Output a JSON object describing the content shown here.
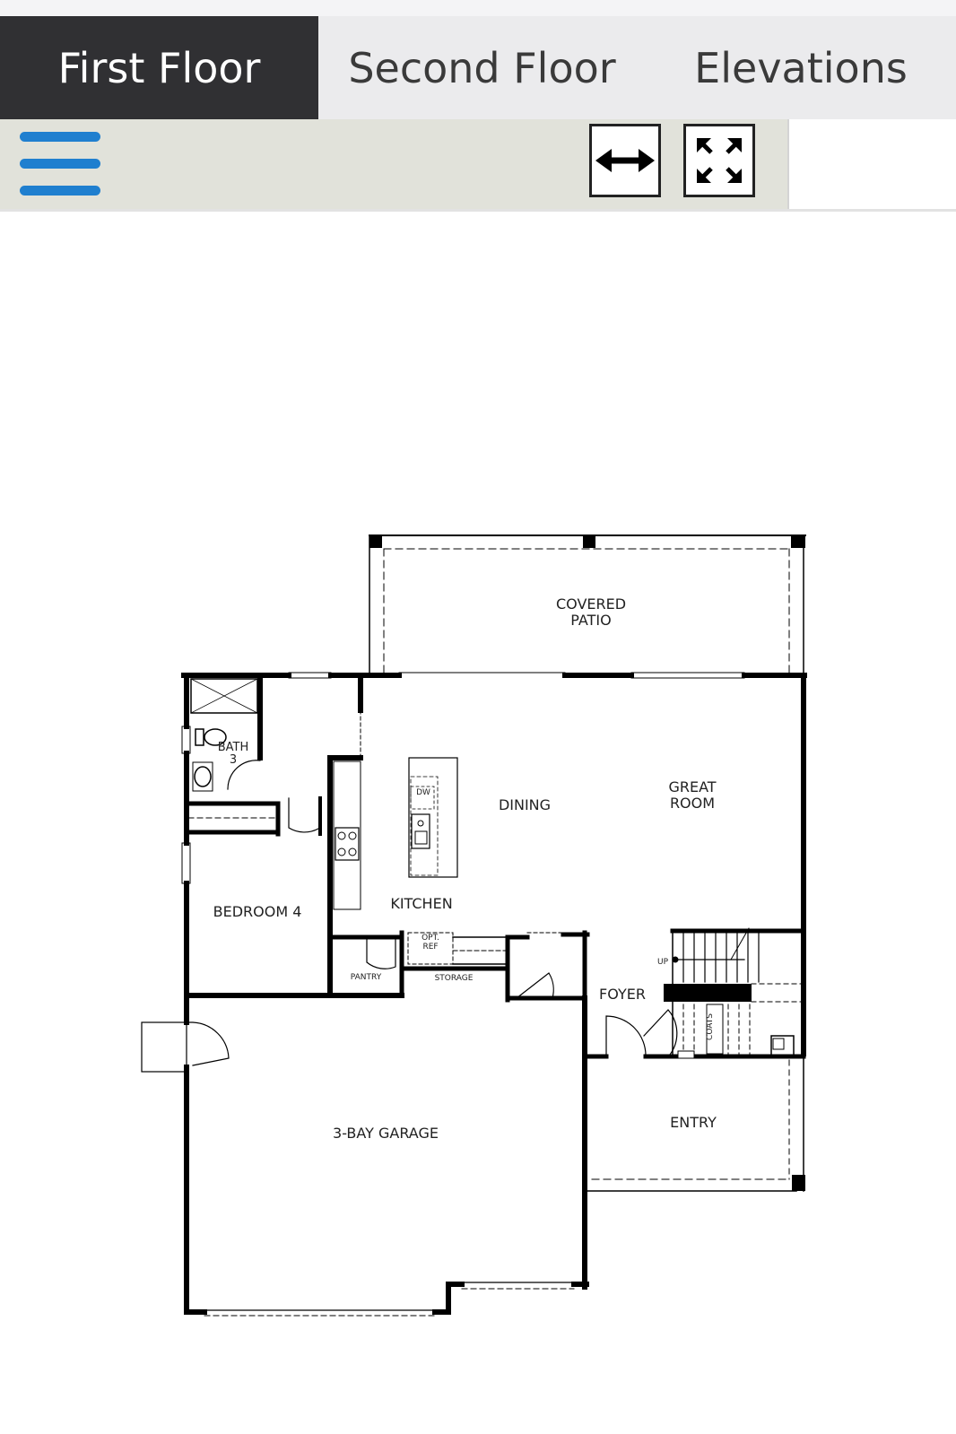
{
  "tabs": [
    {
      "label": "First Floor",
      "active": true
    },
    {
      "label": "Second Floor",
      "active": false
    },
    {
      "label": "Elevations",
      "active": false
    }
  ],
  "toolbar": {
    "menu_icon": "hamburger-menu-icon",
    "fit_width_icon": "horizontal-arrows-icon",
    "fullscreen_icon": "expand-arrows-icon"
  },
  "colors": {
    "active_tab_bg": "#303033",
    "tabbar_bg": "#ebebed",
    "toolbar_bg": "#e1e2da",
    "menu_icon": "#1f7fcf",
    "walls": "#000000"
  },
  "floorplan": {
    "rooms": {
      "covered_patio_1": "COVERED",
      "covered_patio_2": "PATIO",
      "bath_1": "BATH",
      "bath_2": "3",
      "dining": "DINING",
      "great_room_1": "GREAT",
      "great_room_2": "ROOM",
      "kitchen": "KITCHEN",
      "bedroom_4": "BEDROOM 4",
      "pantry": "PANTRY",
      "storage": "STORAGE",
      "opt_ref_1": "OPT.",
      "opt_ref_2": "REF",
      "dw": "DW",
      "foyer": "FOYER",
      "up": "UP",
      "coats": "COATS",
      "entry": "ENTRY",
      "garage": "3-BAY GARAGE"
    }
  }
}
